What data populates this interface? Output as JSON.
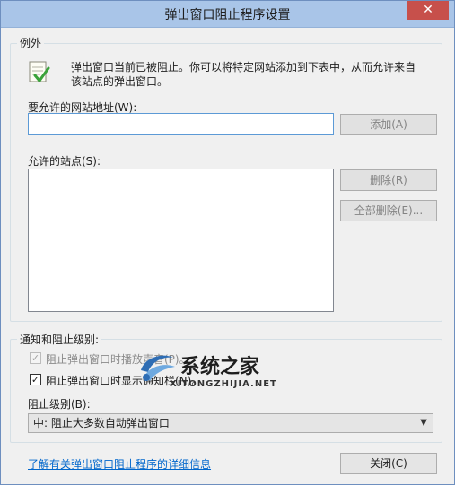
{
  "window": {
    "title": "弹出窗口阻止程序设置",
    "close_glyph": "✕"
  },
  "exceptions": {
    "group_label": "例外",
    "info_line1": "弹出窗口当前已被阻止。你可以将特定网站添加到下表中，从而允许来自",
    "info_line2": "该站点的弹出窗口。",
    "address_label": "要允许的网站地址(W):",
    "address_value": "",
    "add_button": "添加(A)",
    "allowed_label": "允许的站点(S):",
    "allowed_sites": [],
    "remove_button": "删除(R)",
    "remove_all_button": "全部删除(E)..."
  },
  "notifications": {
    "group_label": "通知和阻止级别:",
    "play_sound_label": "阻止弹出窗口时播放声音(P)。",
    "play_sound_checked": true,
    "show_bar_label": "阻止弹出窗口时显示通知栏(N)。",
    "show_bar_checked": true,
    "level_label": "阻止级别(B):",
    "level_selected": "中: 阻止大多数自动弹出窗口"
  },
  "footer": {
    "learn_more_link": "了解有关弹出窗口阻止程序的详细信息",
    "close_button": "关闭(C)"
  },
  "watermark": {
    "brand": "系统之家",
    "url": "XITONGZHIJIA.NET"
  },
  "colors": {
    "titlebar": "#a9c5e8",
    "close_button": "#c7504b",
    "link": "#0066cc",
    "watermark_blue": "#2e6db4"
  }
}
